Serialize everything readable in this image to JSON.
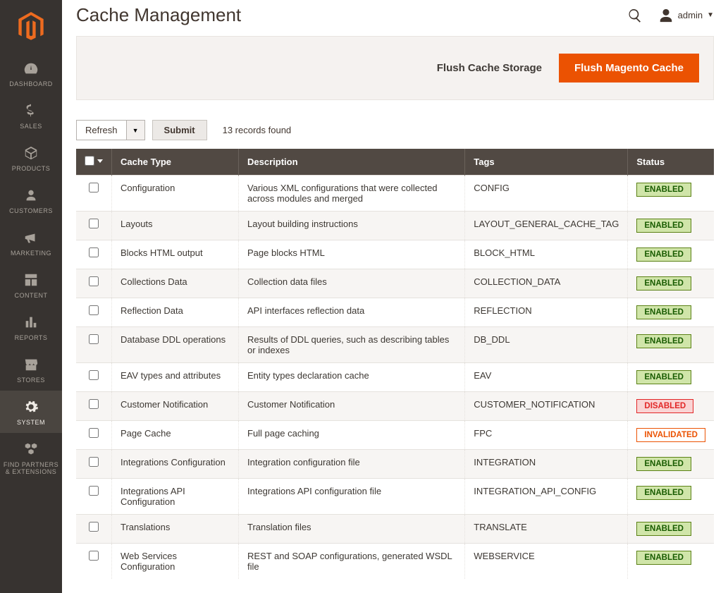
{
  "header": {
    "title": "Cache Management",
    "user_label": "admin"
  },
  "actions": {
    "flush_storage": "Flush Cache Storage",
    "flush_magento": "Flush Magento Cache"
  },
  "toolbar": {
    "refresh": "Refresh",
    "submit": "Submit",
    "records": "13 records found"
  },
  "table": {
    "columns": {
      "cache_type": "Cache Type",
      "description": "Description",
      "tags": "Tags",
      "status": "Status"
    },
    "rows": [
      {
        "type": "Configuration",
        "description": "Various XML configurations that were collected across modules and merged",
        "tags": "CONFIG",
        "status": "ENABLED"
      },
      {
        "type": "Layouts",
        "description": "Layout building instructions",
        "tags": "LAYOUT_GENERAL_CACHE_TAG",
        "status": "ENABLED"
      },
      {
        "type": "Blocks HTML output",
        "description": "Page blocks HTML",
        "tags": "BLOCK_HTML",
        "status": "ENABLED"
      },
      {
        "type": "Collections Data",
        "description": "Collection data files",
        "tags": "COLLECTION_DATA",
        "status": "ENABLED"
      },
      {
        "type": "Reflection Data",
        "description": "API interfaces reflection data",
        "tags": "REFLECTION",
        "status": "ENABLED"
      },
      {
        "type": "Database DDL operations",
        "description": "Results of DDL queries, such as describing tables or indexes",
        "tags": "DB_DDL",
        "status": "ENABLED"
      },
      {
        "type": "EAV types and attributes",
        "description": "Entity types declaration cache",
        "tags": "EAV",
        "status": "ENABLED"
      },
      {
        "type": "Customer Notification",
        "description": "Customer Notification",
        "tags": "CUSTOMER_NOTIFICATION",
        "status": "DISABLED"
      },
      {
        "type": "Page Cache",
        "description": "Full page caching",
        "tags": "FPC",
        "status": "INVALIDATED"
      },
      {
        "type": "Integrations Configuration",
        "description": "Integration configuration file",
        "tags": "INTEGRATION",
        "status": "ENABLED"
      },
      {
        "type": "Integrations API Configuration",
        "description": "Integrations API configuration file",
        "tags": "INTEGRATION_API_CONFIG",
        "status": "ENABLED"
      },
      {
        "type": "Translations",
        "description": "Translation files",
        "tags": "TRANSLATE",
        "status": "ENABLED"
      },
      {
        "type": "Web Services Configuration",
        "description": "REST and SOAP configurations, generated WSDL file",
        "tags": "WEBSERVICE",
        "status": "ENABLED"
      }
    ]
  },
  "sidebar": {
    "items": [
      {
        "label": "DASHBOARD",
        "icon": "gauge"
      },
      {
        "label": "SALES",
        "icon": "dollar"
      },
      {
        "label": "PRODUCTS",
        "icon": "box"
      },
      {
        "label": "CUSTOMERS",
        "icon": "person"
      },
      {
        "label": "MARKETING",
        "icon": "megaphone"
      },
      {
        "label": "CONTENT",
        "icon": "layout"
      },
      {
        "label": "REPORTS",
        "icon": "bars"
      },
      {
        "label": "STORES",
        "icon": "storefront"
      },
      {
        "label": "SYSTEM",
        "icon": "gear",
        "active": true
      },
      {
        "label": "FIND PARTNERS & EXTENSIONS",
        "icon": "cubes"
      }
    ]
  }
}
